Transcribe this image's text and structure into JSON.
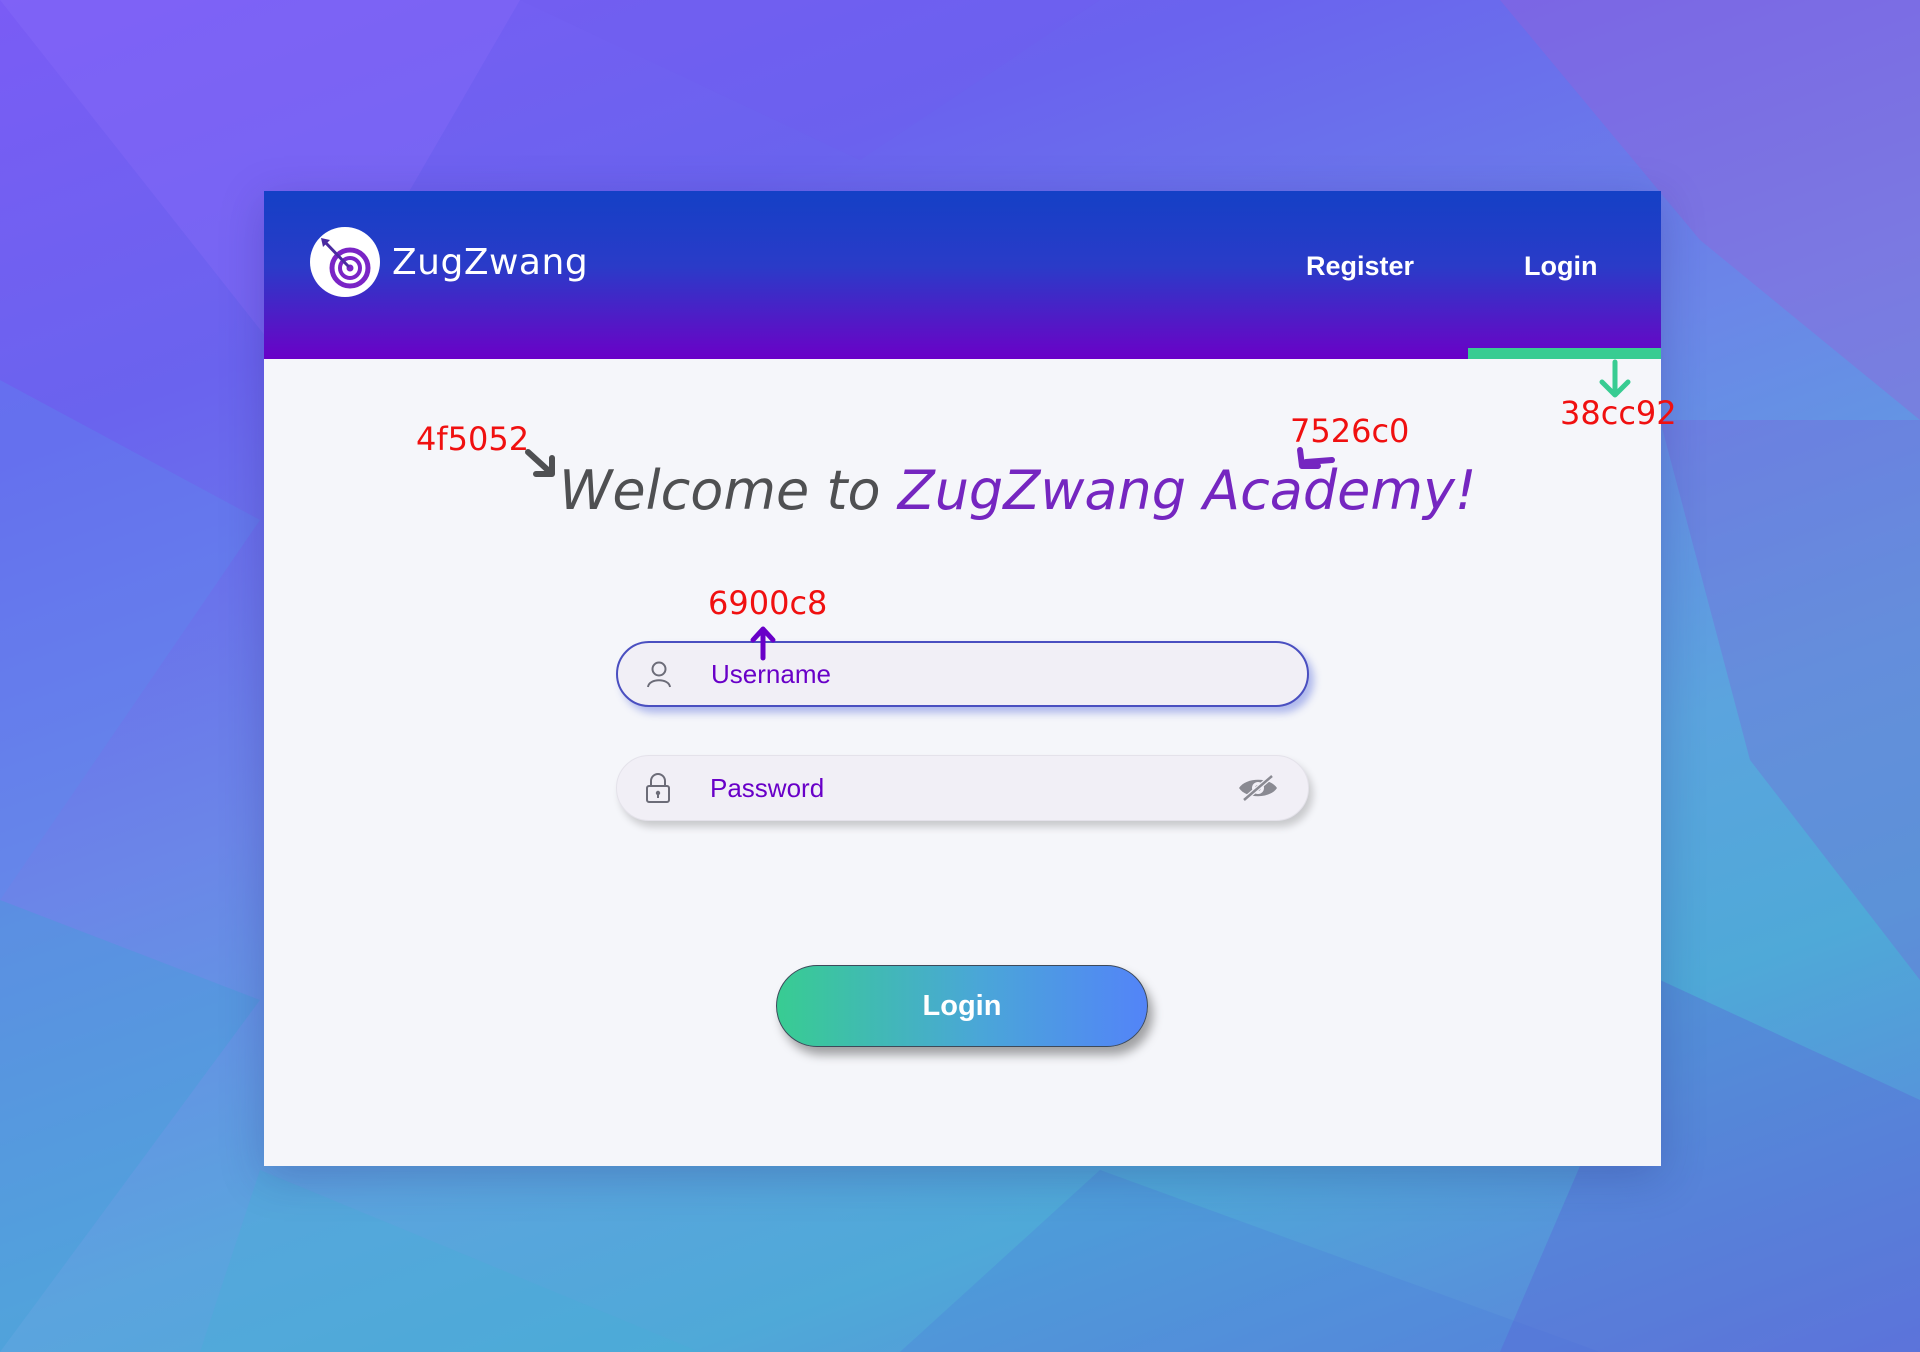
{
  "app": {
    "brand_name": "ZugZwang",
    "logo_icon": "target-arrow-icon"
  },
  "nav": {
    "register_label": "Register",
    "login_label": "Login",
    "active_item": "login"
  },
  "main": {
    "welcome_prefix": "Welcome to ",
    "welcome_accent": "ZugZwang Academy!"
  },
  "form": {
    "username": {
      "placeholder": "Username",
      "icon": "user-icon"
    },
    "password": {
      "placeholder": "Password",
      "icon": "lock-icon",
      "toggle_icon": "eye-off-icon"
    },
    "submit_label": "Login"
  },
  "annotations": {
    "heading_color": "4f5052",
    "accent_color": "7526c0",
    "input_text_color": "6900c8",
    "underline_color": "38cc92"
  },
  "colors": {
    "heading": "#4f5052",
    "accent": "#7526c0",
    "input_text": "#6900c8",
    "active_underline": "#38cc92",
    "header_top": "#1440c6",
    "header_bottom": "#6900c8",
    "button_start": "#38cc92",
    "button_end": "#5384f8"
  }
}
